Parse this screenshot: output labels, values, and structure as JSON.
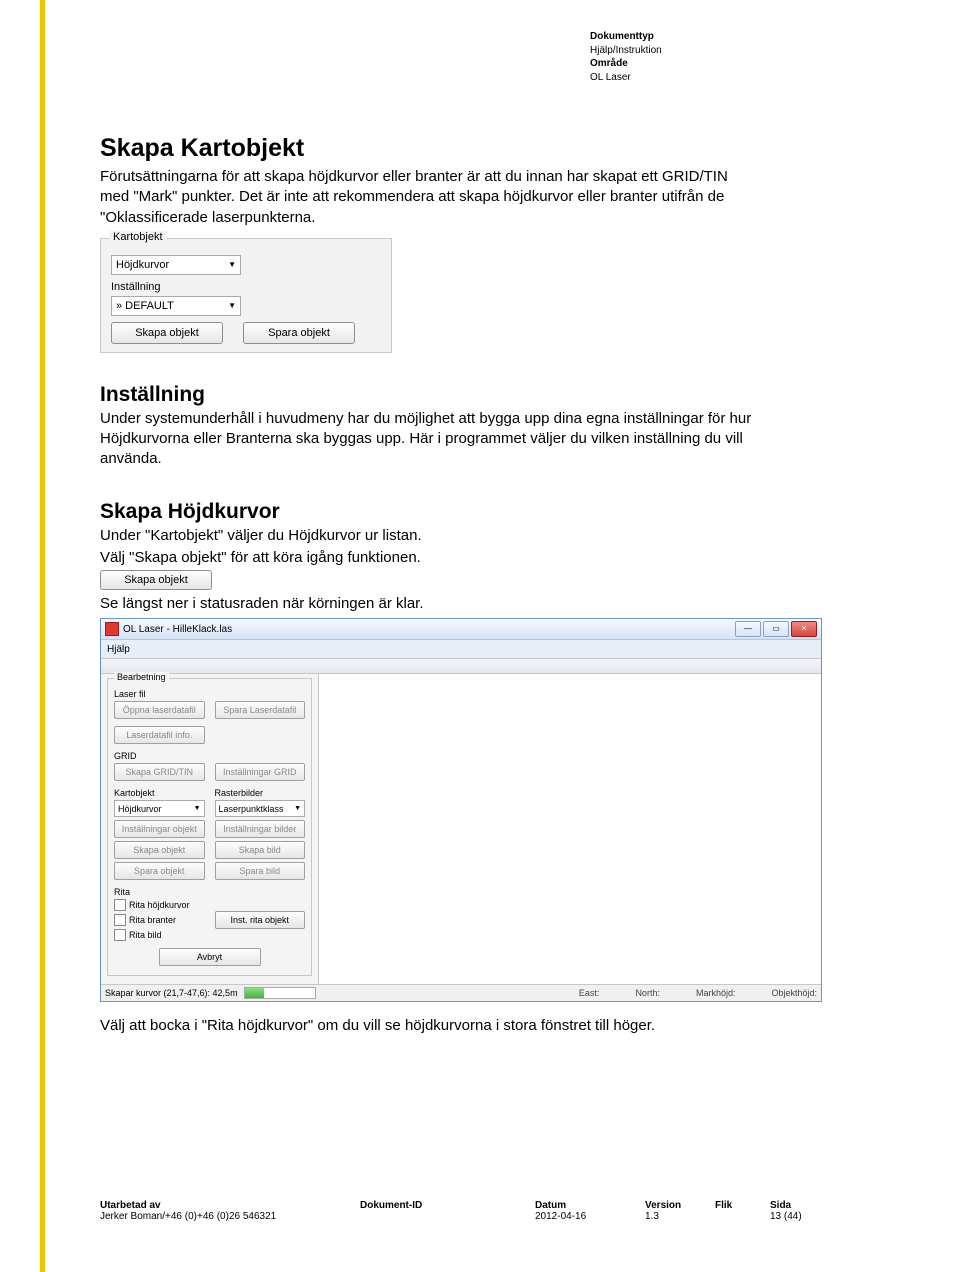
{
  "meta": {
    "doctype_label": "Dokumenttyp",
    "doctype": "Hjälp/Instruktion",
    "area_label": "Område",
    "area": "OL Laser"
  },
  "h1": "Skapa Kartobjekt",
  "p1": "Förutsättningarna för att skapa höjdkurvor eller branter är att du innan har skapat ett GRID/TIN med \"Mark\" punkter. Det är inte att rekommendera att skapa höjdkurvor eller branter utifrån de \"Oklassificerade laserpunkterna.",
  "panel": {
    "legend": "Kartobjekt",
    "combo1": "Höjdkurvor",
    "label2": "Inställning",
    "combo2": "» DEFAULT",
    "btn_create": "Skapa objekt",
    "btn_save": "Spara objekt"
  },
  "h2a": "Inställning",
  "p2": "Under systemunderhåll i huvudmeny har du möjlighet att bygga upp dina egna inställningar för hur Höjdkurvorna eller Branterna ska byggas upp. Här i programmet väljer du vilken inställning du vill använda.",
  "h2b": "Skapa Höjdkurvor",
  "p3": "Under \"Kartobjekt\" väljer du Höjdkurvor ur listan.",
  "p4": "Välj \"Skapa objekt\" för att köra igång funktionen.",
  "inline_btn": "Skapa objekt",
  "p5": "Se längst ner i statusraden när körningen är klar.",
  "app": {
    "title": "OL Laser - HilleKlack.las",
    "menu": "Hjälp",
    "bearbetning": "Bearbetning",
    "laser": {
      "label": "Laser fil",
      "open": "Öppna laserdatafil",
      "save": "Spara Laserdatafil",
      "info": "Laserdatafil info."
    },
    "grid": {
      "label": "GRID",
      "create": "Skapa GRID/TIN",
      "settings": "Inställningar GRID"
    },
    "kart": {
      "label": "Kartobjekt",
      "combo": "Höjdkurvor",
      "settings": "Inställningar objekt",
      "create": "Skapa objekt",
      "save": "Spara objekt"
    },
    "raster": {
      "label": "Rasterbilder",
      "combo": "Laserpunktklass",
      "settings": "Inställningar bilder",
      "create": "Skapa bild",
      "save": "Spara bild"
    },
    "rita": {
      "label": "Rita",
      "hk": "Rita höjdkurvor",
      "br": "Rita branter",
      "bild": "Rita bild",
      "inst": "Inst. rita objekt"
    },
    "abort": "Avbryt",
    "status": {
      "text": "Skapar kurvor  (21,7-47,6): 42,5m",
      "east": "East:",
      "north": "North:",
      "mark": "Markhöjd:",
      "obj": "Objekthöjd:"
    }
  },
  "p6": "Välj att bocka i \"Rita höjdkurvor\" om du vill se höjdkurvorna i stora fönstret till höger.",
  "footer": {
    "author_l": "Utarbetad av",
    "author": "Jerker Boman/+46 (0)+46 (0)26 546321",
    "docid_l": "Dokument-ID",
    "docid": "",
    "date_l": "Datum",
    "date": "2012-04-16",
    "ver_l": "Version",
    "ver": "1.3",
    "flik_l": "Flik",
    "flik": "",
    "sida_l": "Sida",
    "sida": "13 (44)"
  }
}
